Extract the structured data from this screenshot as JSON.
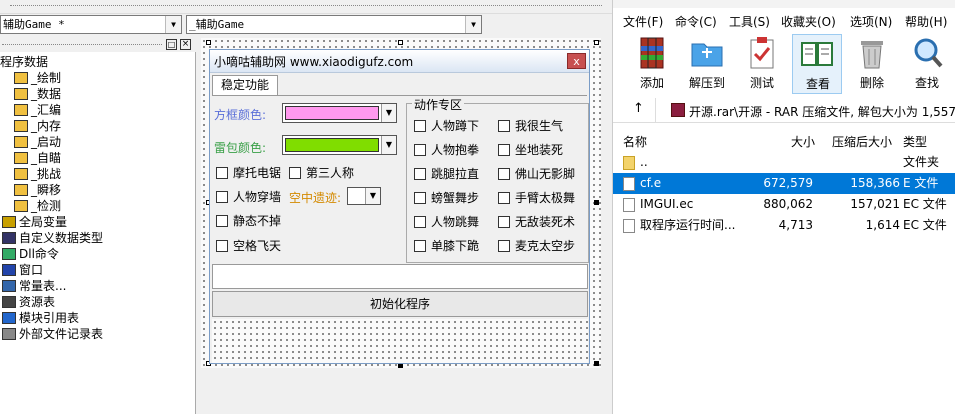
{
  "ide": {
    "combo_left": "辅助Game *",
    "combo_right": "_辅助Game",
    "tree_items": [
      {
        "label": "程序数据",
        "icon": "none"
      },
      {
        "label": "_绘制",
        "icon": "module-icon"
      },
      {
        "label": "_数据",
        "icon": "module-icon"
      },
      {
        "label": "_汇编",
        "icon": "module-icon"
      },
      {
        "label": "_内存",
        "icon": "module-icon"
      },
      {
        "label": "_启动",
        "icon": "module-icon"
      },
      {
        "label": "_自瞄",
        "icon": "module-icon"
      },
      {
        "label": "_挑战",
        "icon": "module-icon"
      },
      {
        "label": "_瞬移",
        "icon": "module-icon"
      },
      {
        "label": "_检测",
        "icon": "module-icon"
      },
      {
        "label": "全局变量",
        "icon": "globals-icon"
      },
      {
        "label": "自定义数据类型",
        "icon": "datatype-icon"
      },
      {
        "label": "Dll命令",
        "icon": "dll-icon"
      },
      {
        "label": "窗口",
        "icon": "window-icon"
      },
      {
        "label": "常量表...",
        "icon": "const-icon"
      },
      {
        "label": "资源表",
        "icon": "resource-icon"
      },
      {
        "label": "模块引用表",
        "icon": "moduleref-icon"
      },
      {
        "label": "外部文件记录表",
        "icon": "extfile-icon"
      }
    ],
    "form": {
      "title": "小嘀咕辅助网 www.xiaodigufz.com",
      "close": "x",
      "tab": "稳定功能",
      "box_color_label": "方框颜色:",
      "box_color_hex": "#ff99ee",
      "bag_color_label": "雷包颜色:",
      "bag_color_hex": "#80dd00",
      "checks_left": [
        "摩托电锯",
        "第三人称",
        "人物穿墙",
        "静态不掉",
        "空格飞天"
      ],
      "air_label": "空中遗迹:",
      "group_title": "动作专区",
      "group_col1": [
        "人物蹲下",
        "人物抱拳",
        "跳腿拉直",
        "螃蟹舞步",
        "人物跳舞",
        "单膝下跪"
      ],
      "group_col2": [
        "我很生气",
        "坐地装死",
        "佛山无影脚",
        "手臂太极舞",
        "无敌装死术",
        "麦克太空步"
      ],
      "init_button": "初始化程序"
    }
  },
  "explorer": {
    "menus": [
      "文件(F)",
      "命令(C)",
      "工具(S)",
      "收藏夹(O)",
      "选项(N)",
      "帮助(H)"
    ],
    "toolbar": [
      "添加",
      "解压到",
      "测试",
      "查看",
      "删除",
      "查找"
    ],
    "path": "开源.rar\\开源 - RAR 压缩文件, 解包大小为 1,557",
    "columns": [
      "名称",
      "大小",
      "压缩后大小",
      "类型"
    ],
    "rows": [
      {
        "name": "..",
        "size": "",
        "packed": "",
        "type": "文件夹",
        "icon": "folder-icon"
      },
      {
        "name": "cf.e",
        "size": "672,579",
        "packed": "158,366",
        "type": "E 文件",
        "icon": "file-icon",
        "selected": true
      },
      {
        "name": "IMGUI.ec",
        "size": "880,062",
        "packed": "157,021",
        "type": "EC 文件",
        "icon": "file-icon"
      },
      {
        "name": "取程序运行时间...",
        "size": "4,713",
        "packed": "1,614",
        "type": "EC 文件",
        "icon": "file-icon"
      }
    ]
  }
}
